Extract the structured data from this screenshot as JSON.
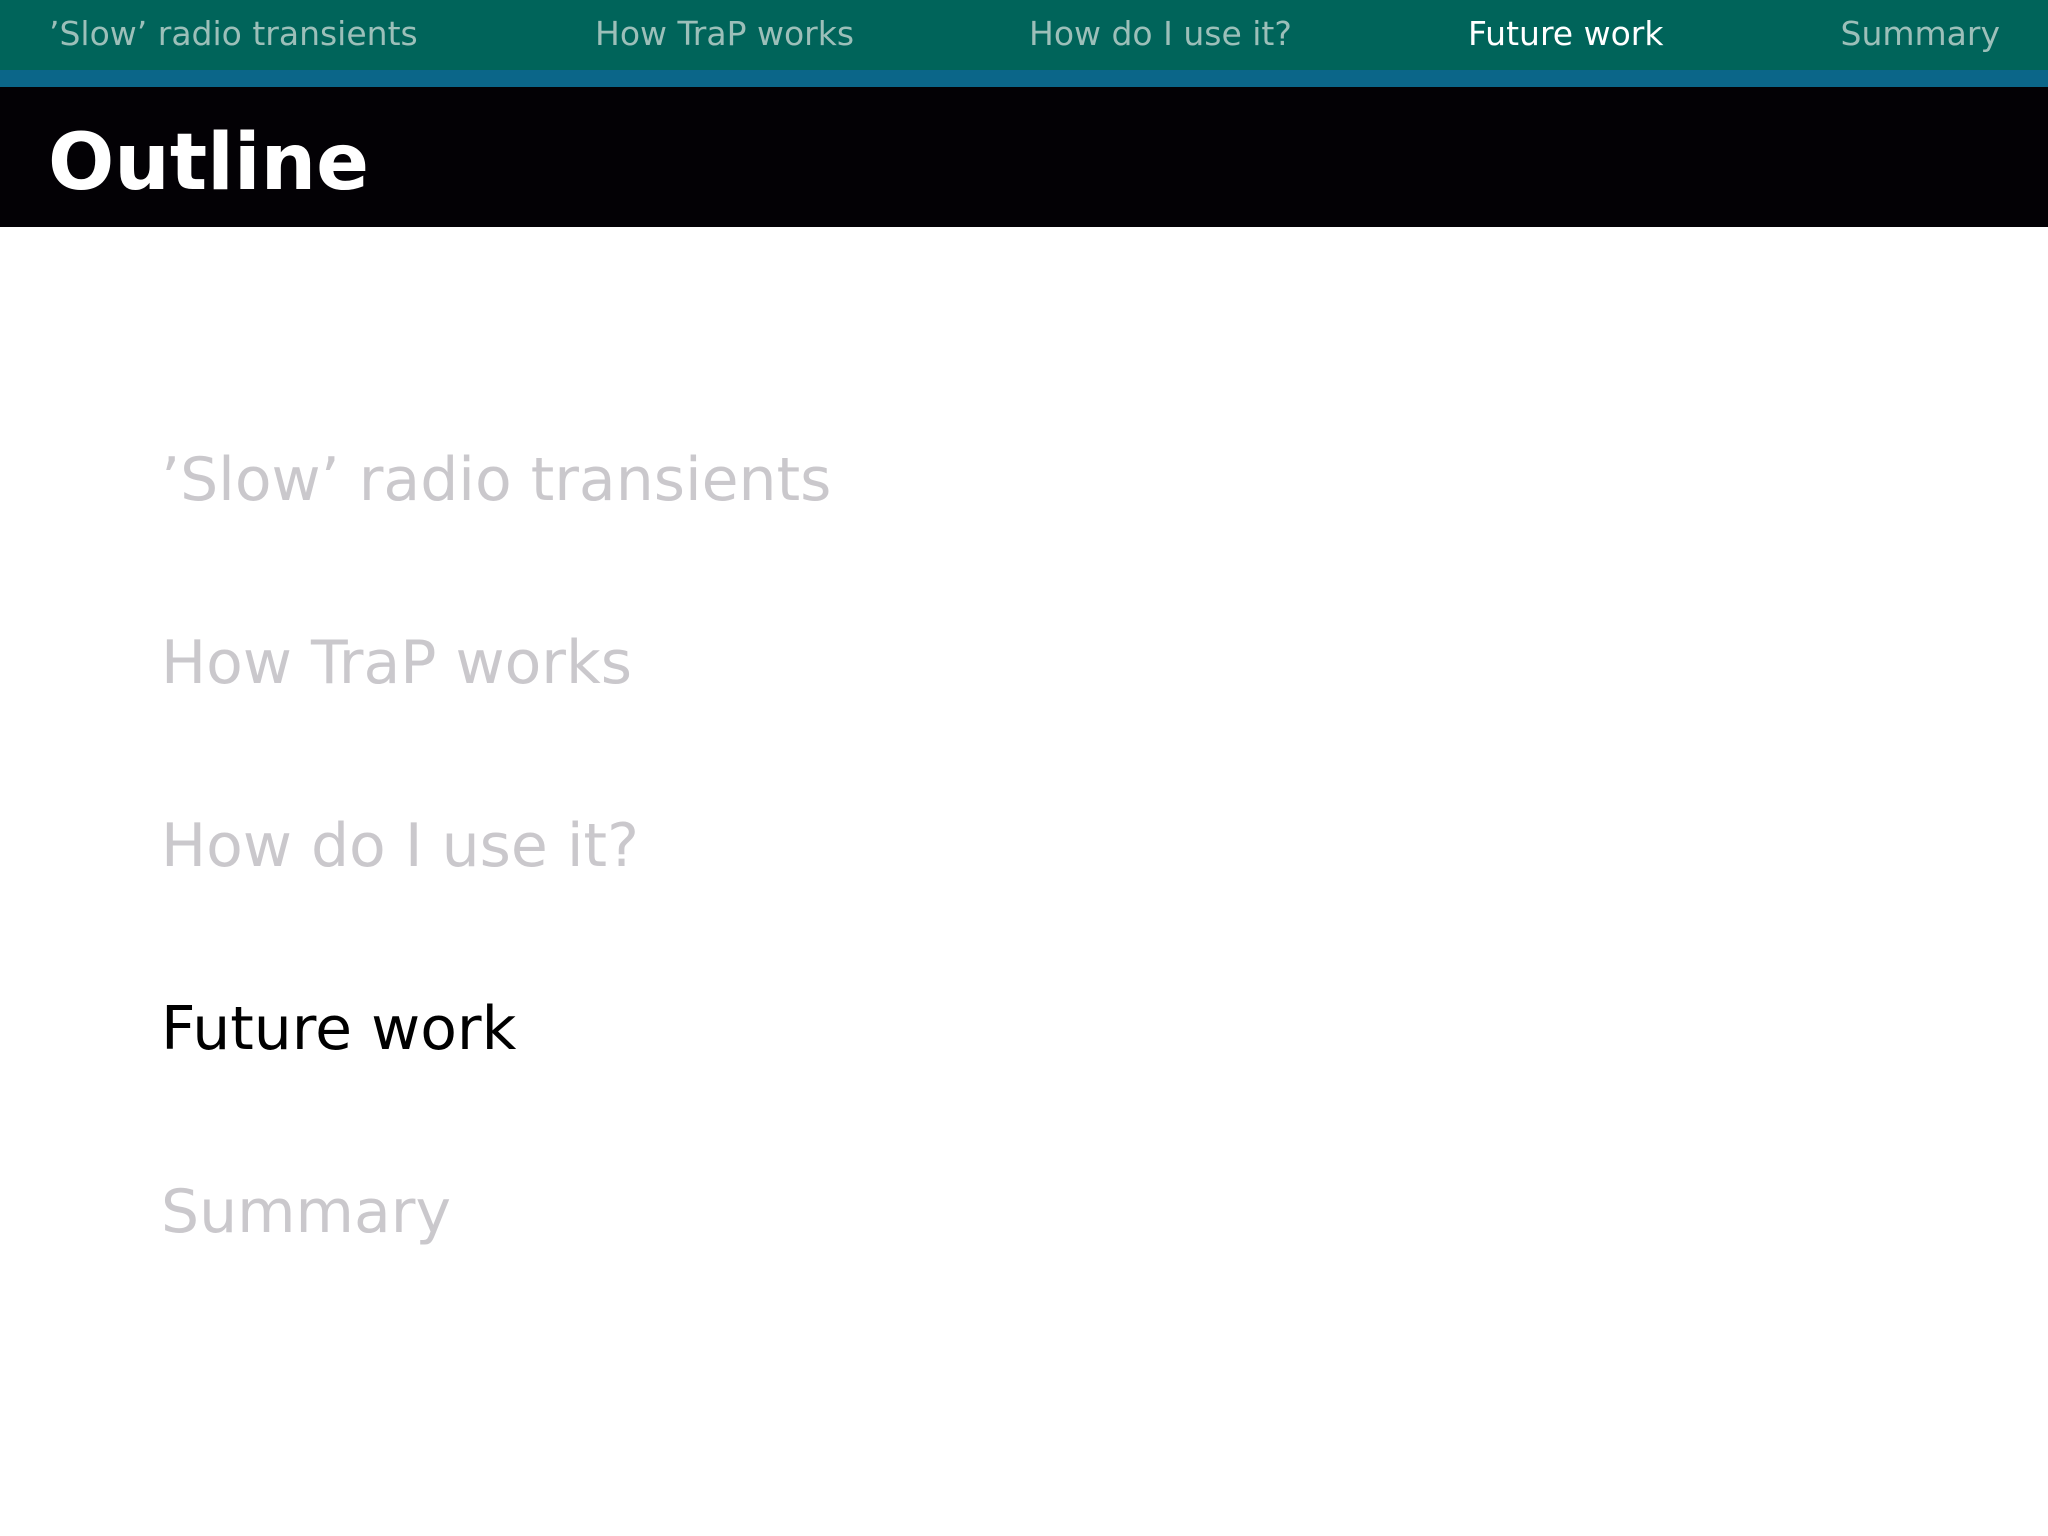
{
  "nav": {
    "items": [
      {
        "label": "’Slow’ radio transients"
      },
      {
        "label": "How TraP works"
      },
      {
        "label": "How do I use it?"
      },
      {
        "label": "Future work"
      },
      {
        "label": "Summary"
      }
    ],
    "active_index": 3
  },
  "slide": {
    "title": "Outline"
  },
  "toc": {
    "items": [
      {
        "label": "’Slow’ radio transients"
      },
      {
        "label": "How TraP works"
      },
      {
        "label": "How do I use it?"
      },
      {
        "label": "Future work"
      },
      {
        "label": "Summary"
      }
    ],
    "active_index": 3
  },
  "colors": {
    "nav_background": "#00645a",
    "nav_stripe": "#0b6689",
    "title_background": "#030105",
    "inactive_text": "#cac8cc",
    "active_nav_text": "#ffffff",
    "active_toc_text": "#000000"
  }
}
